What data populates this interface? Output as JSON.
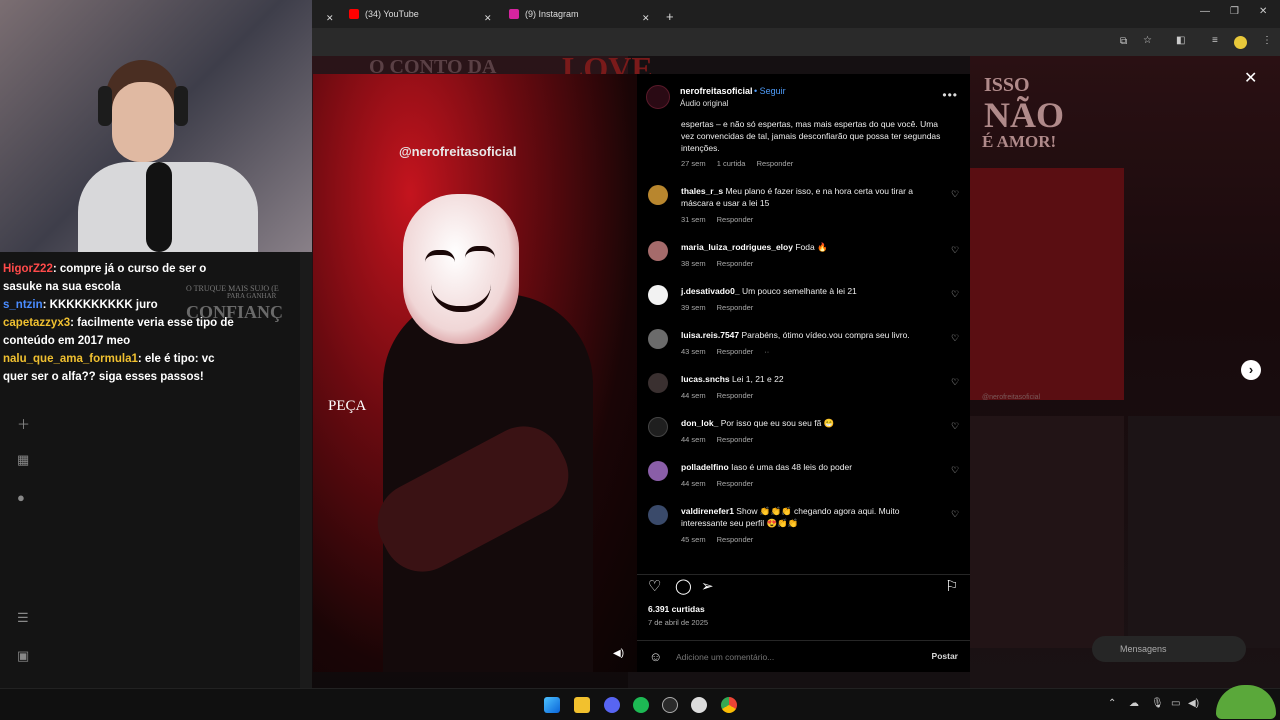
{
  "browser": {
    "tabs": [
      {
        "label": "(34) YouTube",
        "color": "#ff0000"
      },
      {
        "label": "(9) Instagram",
        "color": "#d6249f"
      }
    ]
  },
  "chat": {
    "messages": [
      {
        "user": "HigorZ22",
        "user_color": "#ff4a4a",
        "text": "compre já o curso de ser o sasuke na sua escola"
      },
      {
        "user": "s_ntzin",
        "user_color": "#4a8cff",
        "text": "KKKKKKKKKK juro"
      },
      {
        "user": "capetazzyx3",
        "user_color": "#f0c030",
        "text": "facilmente veria esse tipo de conteúdo em 2017 meo"
      },
      {
        "user": "nalu_que_ama_formula1",
        "user_color": "#f0c030",
        "text": "ele é tipo: vc quer ser o alfa?? siga esses passos!"
      }
    ]
  },
  "backdrop": {
    "title_left": "O CONTO DA",
    "title_love": "LOVE",
    "right_top": "ISSO",
    "right_mid": "NÃO",
    "right_bottom": "É AMOR!",
    "left_sub": "O TRUQUE MAIS SUJO (E",
    "left_sub2": "PARA GANHAR",
    "left_big": "CONFIANÇ",
    "watermark_right": "@nerofreitasoficial"
  },
  "reel": {
    "watermark": "@nerofreitasoficial",
    "caption": "PEÇA"
  },
  "post": {
    "username": "nerofreitasoficial",
    "follow": "Seguir",
    "audio": "Áudio original",
    "caption": "espertas – e não só espertas, mas mais espertas do que você. Uma vez convencidas de tal, jamais desconfiarão que possa ter segundas intenções.",
    "caption_time": "27 sem",
    "caption_likes": "1 curtida",
    "caption_reply": "Responder",
    "likes": "6.391 curtidas",
    "date": "7 de abril de 2025",
    "add_comment_placeholder": "Adicione um comentário...",
    "post_label": "Postar",
    "messages_label": "Mensagens"
  },
  "comments": [
    {
      "user": "thales_r_s",
      "text": "Meu plano é fazer isso, e na hora certa vou tirar a máscara e usar a lei 15",
      "time": "31 sem",
      "reply": "Responder",
      "avatar_color": "#b8862e"
    },
    {
      "user": "maria_luiza_rodrigues_eloy",
      "text": "Foda 🔥",
      "time": "38 sem",
      "reply": "Responder",
      "avatar_color": "#a56b6b"
    },
    {
      "user": "j.desativado0_",
      "text": "Um pouco semelhante à lei 21",
      "time": "39 sem",
      "reply": "Responder",
      "avatar_color": "#f2f2f2"
    },
    {
      "user": "luisa.reis.7547",
      "text": "Parabéns, ótimo vídeo.vou compra seu livro.",
      "time": "43 sem",
      "reply": "Responder",
      "avatar_color": "#6b6b6b"
    },
    {
      "user": "lucas.snchs",
      "text": "Lei 1, 21 e 22",
      "time": "44 sem",
      "reply": "Responder",
      "avatar_color": "#3a3030"
    },
    {
      "user": "don_lok_",
      "text": "Por isso que eu sou seu fã 😁",
      "time": "44 sem",
      "reply": "Responder",
      "avatar_color": "#1f1f1f"
    },
    {
      "user": "polladelfino",
      "text": "Iaso é uma das 48 leis do poder",
      "time": "44 sem",
      "reply": "Responder",
      "avatar_color": "#8a5ea8"
    },
    {
      "user": "valdirenefer1",
      "text": "Show 👏👏👏 chegando agora aqui. Muito interessante seu perfil 😍👏👏",
      "time": "45 sem",
      "reply": "Responder",
      "avatar_color": "#3a4a6a"
    }
  ],
  "colors": {
    "accent_follow": "#4f9cf9",
    "panel_bg": "#000000",
    "reel_red": "#c4141e"
  },
  "icons": [
    "close-icon",
    "heart-icon",
    "comment-icon",
    "share-icon",
    "bookmark-icon",
    "more-icon",
    "emoji-icon",
    "chevron-right-icon",
    "volume-icon"
  ]
}
